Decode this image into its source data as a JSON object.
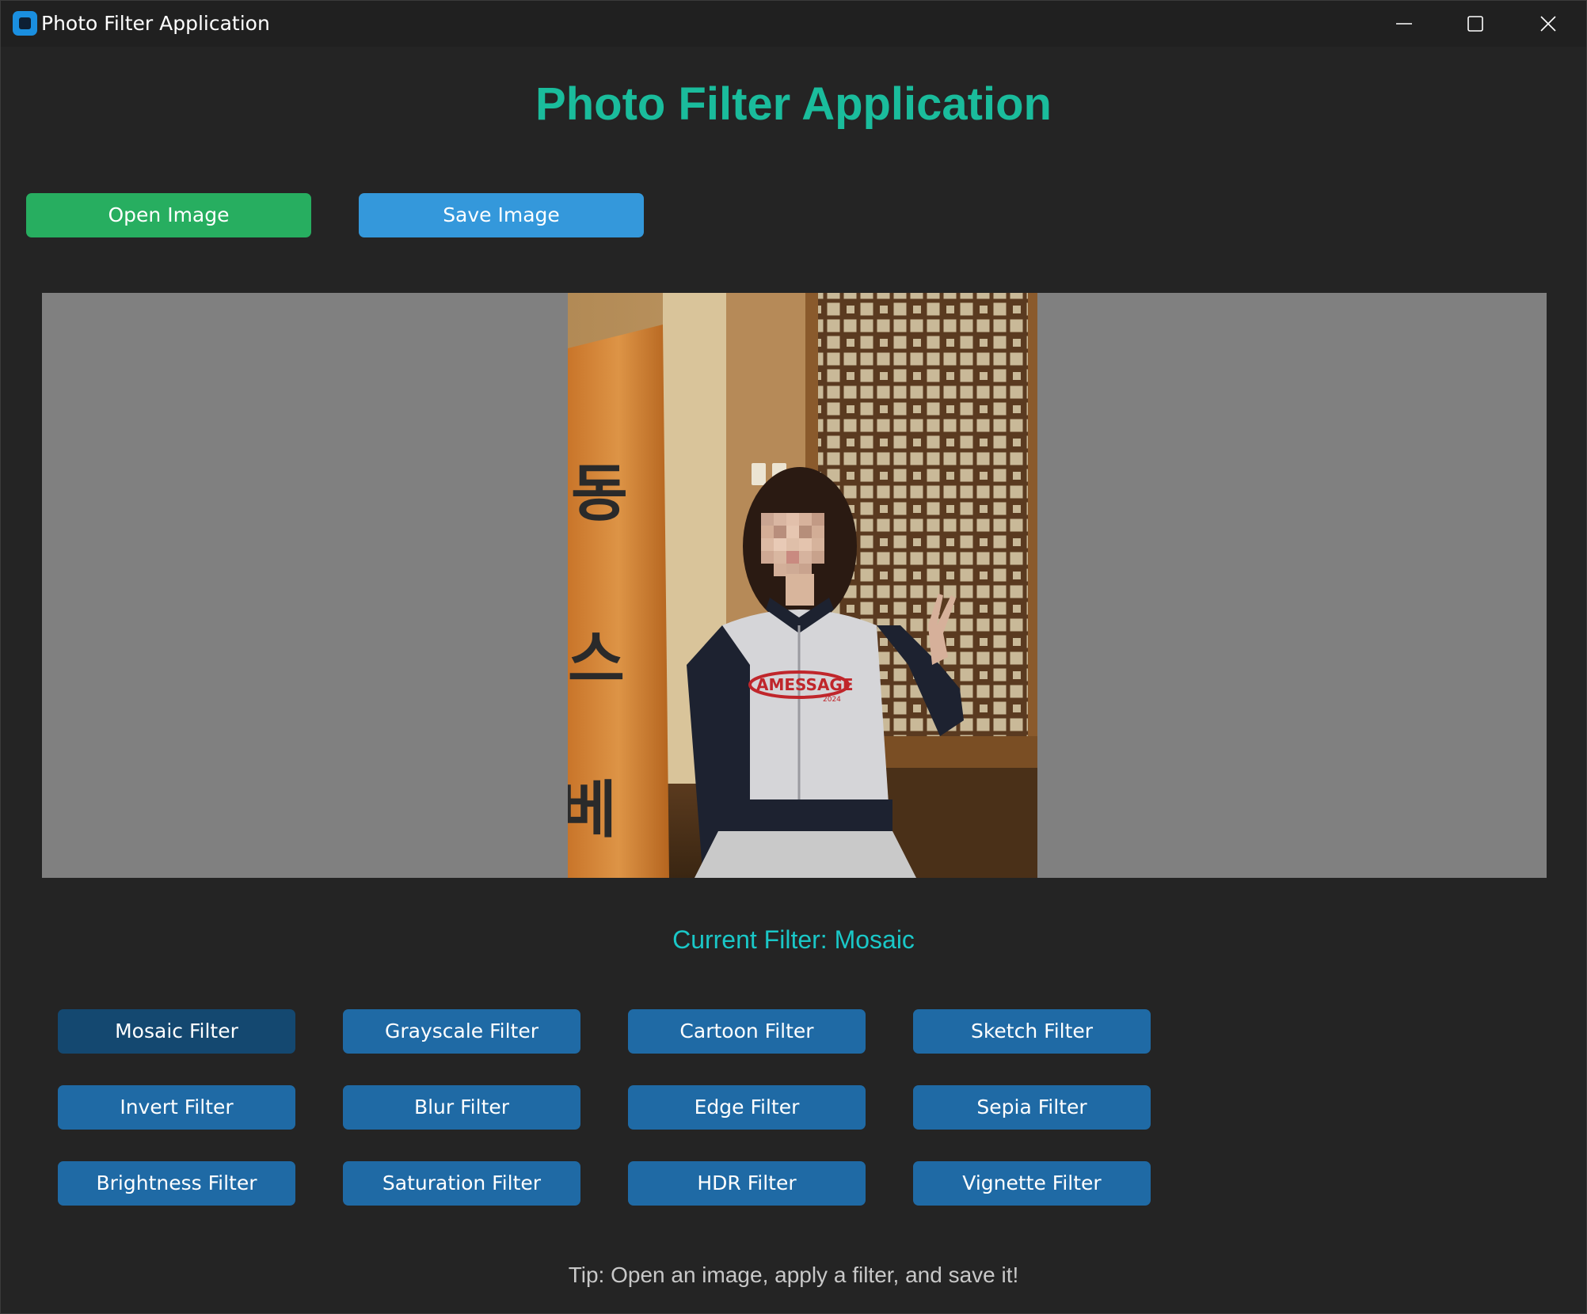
{
  "window": {
    "title": "Photo Filter Application",
    "icon": "app-icon",
    "controls": [
      "minimize-icon",
      "maximize-icon",
      "close-icon"
    ]
  },
  "header": {
    "title": "Photo Filter Application",
    "color": "#1abc9c"
  },
  "toolbar": {
    "open_label": "Open Image",
    "open_color": "#27ae60",
    "save_label": "Save Image",
    "save_color": "#3498db"
  },
  "preview": {
    "background": "#808080",
    "signboard_text": [
      "동",
      "스",
      "베"
    ],
    "shirt_text": "AMESSAGE",
    "shirt_subtext": "2024"
  },
  "status": {
    "current_filter": "Current Filter: Mosaic"
  },
  "filters": [
    {
      "label": "Mosaic Filter",
      "active": true
    },
    {
      "label": "Grayscale Filter",
      "active": false
    },
    {
      "label": "Cartoon Filter",
      "active": false
    },
    {
      "label": "Sketch Filter",
      "active": false
    },
    {
      "label": "Invert Filter",
      "active": false
    },
    {
      "label": "Blur Filter",
      "active": false
    },
    {
      "label": "Edge Filter",
      "active": false
    },
    {
      "label": "Sepia Filter",
      "active": false
    },
    {
      "label": "Brightness Filter",
      "active": false
    },
    {
      "label": "Saturation Filter",
      "active": false
    },
    {
      "label": "HDR Filter",
      "active": false
    },
    {
      "label": "Vignette Filter",
      "active": false
    }
  ],
  "footer": {
    "tip": "Tip: Open an image, apply a filter, and save it!"
  }
}
